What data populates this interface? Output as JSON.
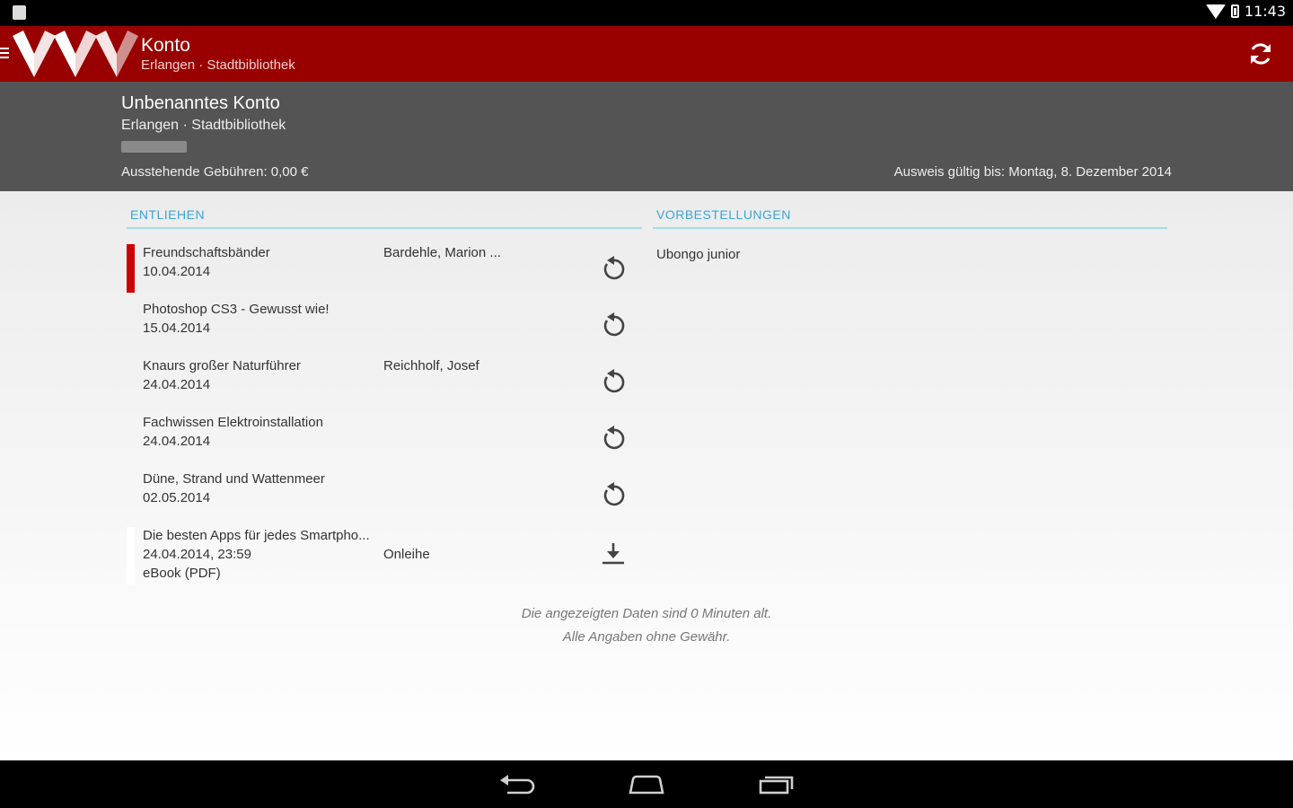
{
  "status_bar": {
    "time": "11:43"
  },
  "action_bar": {
    "title": "Konto",
    "subtitle": "Erlangen · Stadtbibliothek"
  },
  "account": {
    "name": "Unbenanntes Konto",
    "library": "Erlangen · Stadtbibliothek",
    "fees_label": "Ausstehende Gebühren:",
    "fees_value": "0,00 €",
    "valid_label": "Ausweis gültig bis:",
    "valid_value": "Montag, 8. Dezember 2014"
  },
  "lent": {
    "heading": "ENTLIEHEN",
    "items": [
      {
        "title": "Freundschaftsbänder",
        "date": "10.04.2014",
        "author": "Bardehle, Marion ...",
        "action_icon": "renew-icon",
        "marker": "#cc0000"
      },
      {
        "title": "Photoshop CS3 - Gewusst wie!",
        "date": "15.04.2014",
        "author": "",
        "action_icon": "renew-icon",
        "marker": ""
      },
      {
        "title": "Knaurs großer Naturführer",
        "date": "24.04.2014",
        "author": "Reichholf, Josef",
        "action_icon": "renew-icon",
        "marker": ""
      },
      {
        "title": "Fachwissen Elektroinstallation",
        "date": "24.04.2014",
        "author": "",
        "action_icon": "renew-icon",
        "marker": ""
      },
      {
        "title": "Düne, Strand und Wattenmeer",
        "date": "02.05.2014",
        "author": "",
        "action_icon": "renew-icon",
        "marker": ""
      },
      {
        "title": "Die besten Apps für jedes Smartpho...",
        "date": "24.04.2014, 23:59",
        "format": "eBook (PDF)",
        "type": "Onleihe",
        "action_icon": "download-icon",
        "marker": "#ffffff"
      }
    ]
  },
  "reservations": {
    "heading": "VORBESTELLUNGEN",
    "items": [
      {
        "title": "Ubongo junior"
      }
    ]
  },
  "footer": {
    "line1": "Die angezeigten Daten sind 0 Minuten alt.",
    "line2": "Alle Angaben ohne Gewähr."
  },
  "colors": {
    "action_bar": "#990000",
    "account_header": "#545454",
    "section_heading": "#3aa5d6",
    "overdue_marker": "#cc0000"
  }
}
